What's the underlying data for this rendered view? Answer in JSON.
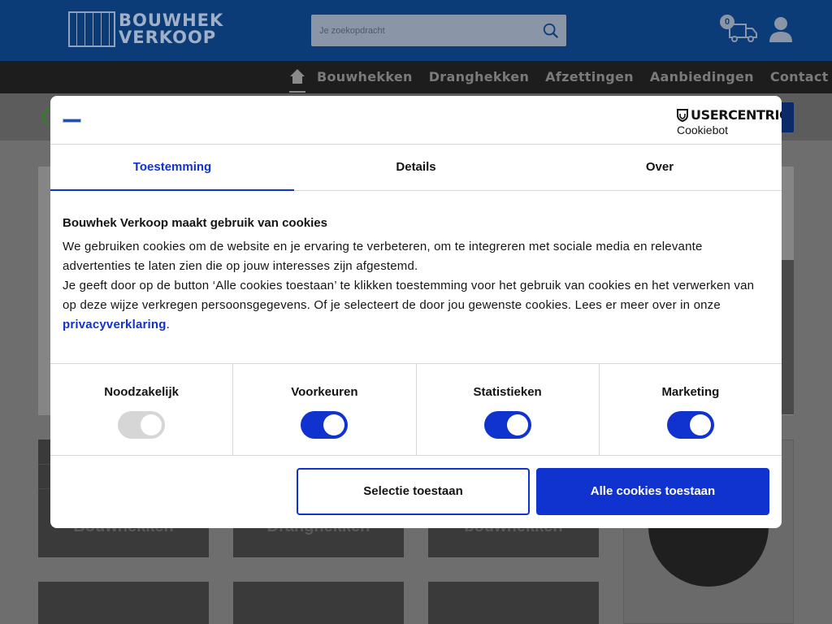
{
  "header": {
    "logo_line1": "BOUWHEK",
    "logo_line2": "VERKOOP",
    "search_placeholder": "Je zoekopdracht",
    "cart_count": "0"
  },
  "nav": {
    "items": [
      "Bouwhekken",
      "Dranghekken",
      "Afzettingen",
      "Aanbiedingen",
      "Contact"
    ]
  },
  "background_tiles": {
    "row1": [
      "Bouwhekken",
      "Dranghekken",
      "bouwhekken"
    ]
  },
  "cookie_dialog": {
    "brand_name": "USERCENTRICS",
    "brand_sub": "Cookiebot",
    "tabs": [
      "Toestemming",
      "Details",
      "Over"
    ],
    "active_tab": "Toestemming",
    "heading": "Bouwhek Verkoop maakt gebruik van cookies",
    "paragraph1": "We gebruiken cookies om de website en je ervaring te verbeteren, om te integreren met sociale media en relevante advertenties te laten zien die op jouw interesses zijn afgestemd.",
    "paragraph2_before": "Je geeft door op de button ‘Alle cookies toestaan’ te klikken toestemming voor het gebruik van cookies en het verwerken van op deze wijze verkregen persoonsgegevens. Of je selecteert de door jou gewenste cookies. Lees er meer over in onze ",
    "privacy_link": "privacyverklaring",
    "paragraph2_after": ".",
    "categories": [
      {
        "label": "Noodzakelijk",
        "enabled": true,
        "disabled": true
      },
      {
        "label": "Voorkeuren",
        "enabled": true,
        "disabled": false
      },
      {
        "label": "Statistieken",
        "enabled": true,
        "disabled": false
      },
      {
        "label": "Marketing",
        "enabled": true,
        "disabled": false
      }
    ],
    "btn_selection": "Selectie toestaan",
    "btn_all": "Alle cookies toestaan",
    "accent_color": "#1032cf"
  }
}
